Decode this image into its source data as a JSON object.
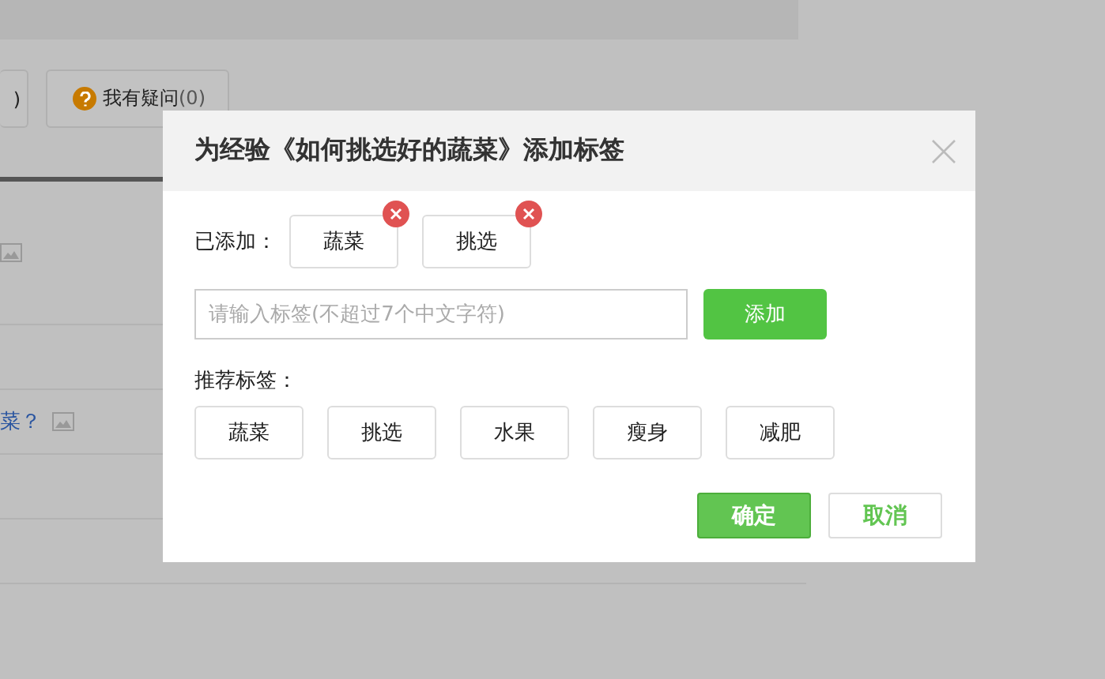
{
  "background": {
    "buttons": [
      {
        "kind": "plain",
        "label": ")"
      },
      {
        "kind": "question",
        "label": "我有疑问",
        "count": "(0)"
      }
    ],
    "rows": [
      {
        "kind": "image"
      },
      {
        "kind": "empty"
      },
      {
        "kind": "link",
        "text": "菜？"
      },
      {
        "kind": "empty"
      },
      {
        "kind": "empty"
      }
    ]
  },
  "dialog": {
    "title": "为经验《如何挑选好的蔬菜》添加标签",
    "added_label": "已添加：",
    "added_tags": [
      "蔬菜",
      "挑选"
    ],
    "input": {
      "placeholder": "请输入标签(不超过7个中文字符)"
    },
    "add_button": "添加",
    "recommend_label": "推荐标签：",
    "recommended_tags": [
      "蔬菜",
      "挑选",
      "水果",
      "瘦身",
      "减肥"
    ],
    "confirm": "确定",
    "cancel": "取消"
  }
}
